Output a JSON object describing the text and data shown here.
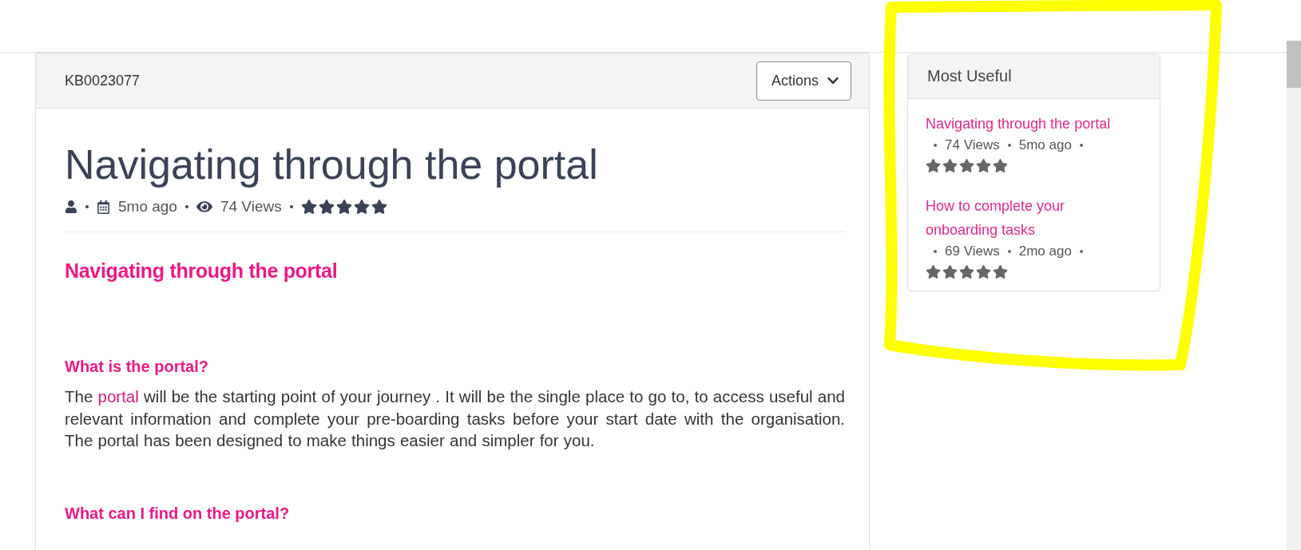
{
  "header": {
    "article_id": "KB0023077",
    "actions_button": "Actions"
  },
  "article": {
    "title": "Navigating through the portal",
    "meta": {
      "age": "5mo ago",
      "views": "74 Views",
      "stars": 5
    },
    "heading": "Navigating through the portal",
    "sections": [
      {
        "heading": "What is the portal?",
        "paragraph": [
          {
            "kind": "text",
            "text": "The "
          },
          {
            "kind": "link",
            "text": "portal"
          },
          {
            "kind": "text",
            "text": " will be the starting point of your journey .  It will be the single place to go to, to access useful and relevant information and complete your pre-boarding tasks before your start date with the organisation. The portal has been designed to make things easier and simpler for you."
          }
        ]
      },
      {
        "heading": "What can I find on the portal?"
      }
    ]
  },
  "sidebar": {
    "title": "Most Useful",
    "items": [
      {
        "title": "Navigating through the portal",
        "views": "74 Views",
        "age": "5mo ago",
        "stars": 5
      },
      {
        "title": "How to complete your onboarding tasks",
        "views": "69 Views",
        "age": "2mo ago",
        "stars": 5
      }
    ]
  }
}
